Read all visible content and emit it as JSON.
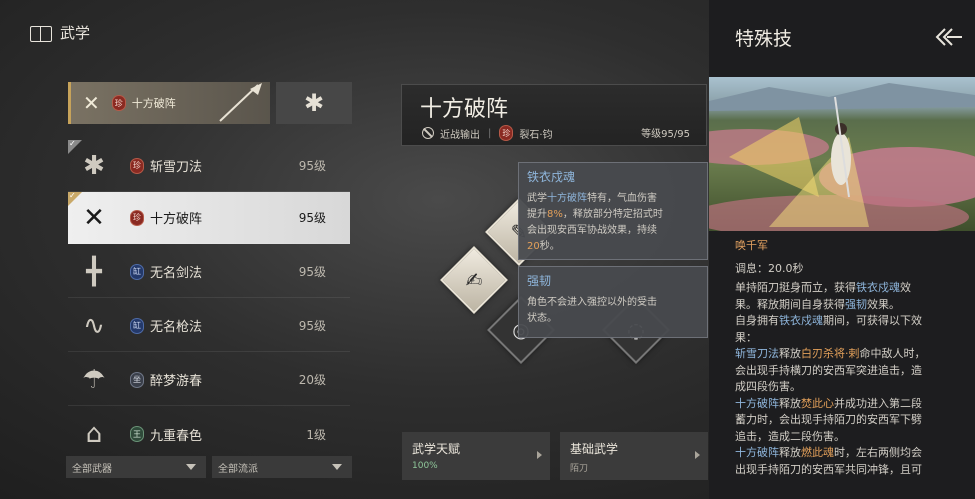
{
  "header": {
    "title": "武学",
    "icon": "book-icon"
  },
  "equipped": {
    "main_label": "十方破阵",
    "main_seal": "珍"
  },
  "list": [
    {
      "icon": "✱",
      "seal": "珍",
      "seal_color": "red",
      "name": "斩雪刀法",
      "level": "95级"
    },
    {
      "icon": "✕",
      "seal": "珍",
      "seal_color": "red",
      "name": "十方破阵",
      "level": "95级"
    },
    {
      "icon": "╋",
      "seal": "缸",
      "seal_color": "blue",
      "name": "无名剑法",
      "level": "95级"
    },
    {
      "icon": "∿",
      "seal": "缸",
      "seal_color": "blue",
      "name": "无名枪法",
      "level": "95级"
    },
    {
      "icon": "☂",
      "seal": "坐",
      "seal_color": "gray",
      "name": "醉梦游春",
      "level": "20级"
    },
    {
      "icon": "⌂",
      "seal": "王",
      "seal_color": "green",
      "name": "九重春色",
      "level": "1级"
    }
  ],
  "filters": {
    "weapon": "全部武器",
    "school": "全部流派"
  },
  "skill": {
    "name": "十方破阵",
    "type": "近战输出",
    "seal": "珍",
    "weapon": "裂石·钧",
    "level": "等级95/95"
  },
  "tooltip1": {
    "title": "铁衣戍魂",
    "line1_a": "武学",
    "line1_hl": "十方破阵",
    "line1_b": "特有，气血伤害",
    "line2_a": "提升",
    "line2_or": "8%",
    "line2_b": "，释放部分特定招式时",
    "line3": "会出现安西军协战效果，持续",
    "line4_or": "20",
    "line4_b": "秒。"
  },
  "tooltip2": {
    "title": "强韧",
    "line1": "角色不会进入强控以外的受击",
    "line2": "状态。"
  },
  "bottom": {
    "talent": "武学天赋",
    "talent_sub": "100%",
    "basic": "基础武学",
    "basic_sub": "陌刀"
  },
  "panel": {
    "title": "特殊技",
    "skill_name": "唤千军",
    "cooldown": "调息：20.0秒",
    "d1": [
      "单持陌刀挺身而立，获得",
      "铁衣戍魂",
      "效"
    ],
    "d2": [
      "果。释放期间自身获得",
      "强韧",
      "效果。"
    ],
    "d3": [
      "自身拥有",
      "铁衣戍魂",
      "期间，可获得以下效"
    ],
    "d4": "果：",
    "d5": [
      "斩雪刀法",
      "释放",
      "白刃杀将·剌",
      "命中敌人时，"
    ],
    "d6": "会出现手持横刀的安西军突进追击，造",
    "d7": "成四段伤害。",
    "d8": [
      "十方破阵",
      "释放",
      "焚此心",
      "并成功进入第二段"
    ],
    "d9": "蓄力时，会出现手持陌刀的安西军下劈",
    "d10": "追击，造成二段伤害。",
    "d11": [
      "十方破阵",
      "释放",
      "燃此魂",
      "时，左右两侧均会"
    ],
    "d12": "出现手持陌刀的安西军共同冲锋，且可"
  }
}
